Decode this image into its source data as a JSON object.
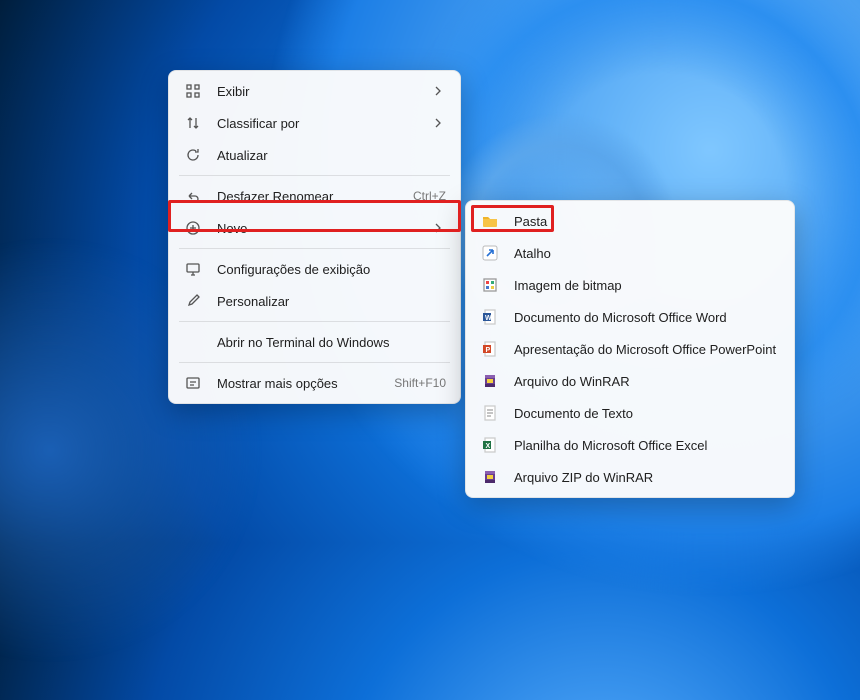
{
  "primaryMenu": {
    "items": [
      {
        "label": "Exibir",
        "icon": "grid",
        "submenu": true
      },
      {
        "label": "Classificar por",
        "icon": "sort",
        "submenu": true
      },
      {
        "label": "Atualizar",
        "icon": "refresh"
      }
    ],
    "group2": [
      {
        "label": "Desfazer Renomear",
        "icon": "undo",
        "shortcut": "Ctrl+Z"
      },
      {
        "label": "Novo",
        "icon": "plus",
        "submenu": true
      }
    ],
    "group3": [
      {
        "label": "Configurações de exibição",
        "icon": "display"
      },
      {
        "label": "Personalizar",
        "icon": "brush"
      }
    ],
    "group4": [
      {
        "label": "Abrir no Terminal do Windows",
        "icon": "none"
      }
    ],
    "group5": [
      {
        "label": "Mostrar mais opções",
        "icon": "more",
        "shortcut": "Shift+F10"
      }
    ]
  },
  "subMenu": {
    "items": [
      {
        "label": "Pasta",
        "icon": "folder"
      },
      {
        "label": "Atalho",
        "icon": "shortcut"
      },
      {
        "label": "Imagem de bitmap",
        "icon": "bitmap"
      },
      {
        "label": "Documento do Microsoft Office Word",
        "icon": "word"
      },
      {
        "label": "Apresentação do Microsoft Office PowerPoint",
        "icon": "ppt"
      },
      {
        "label": "Arquivo do WinRAR",
        "icon": "rar"
      },
      {
        "label": "Documento de Texto",
        "icon": "txt"
      },
      {
        "label": "Planilha do Microsoft Office Excel",
        "icon": "excel"
      },
      {
        "label": "Arquivo ZIP do WinRAR",
        "icon": "zip"
      }
    ]
  }
}
